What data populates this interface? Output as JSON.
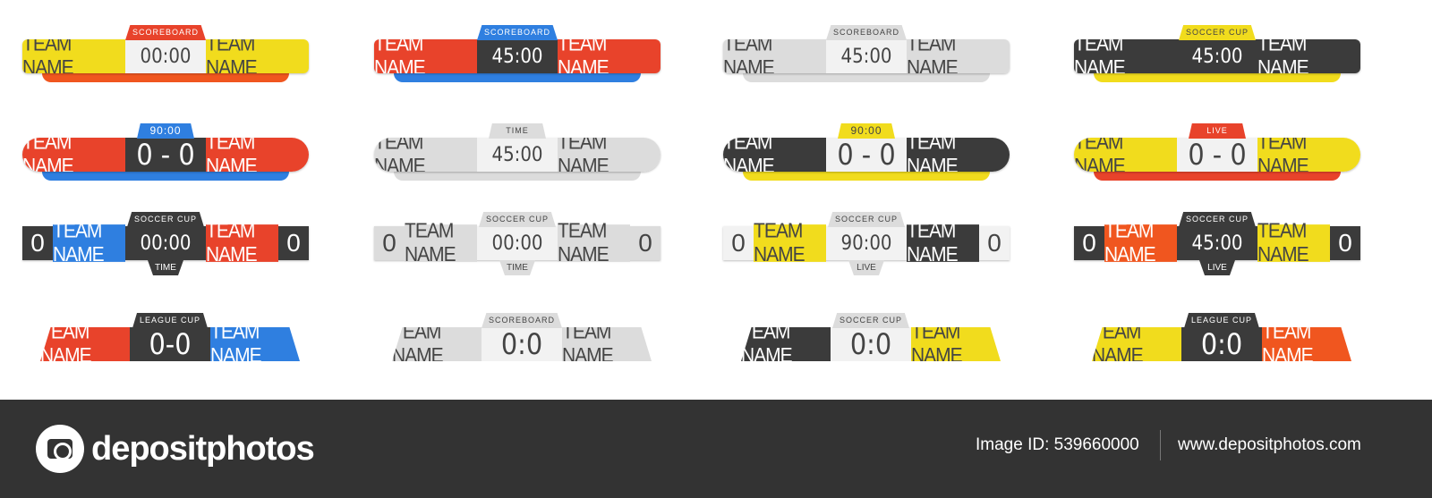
{
  "colors": {
    "yellow": "#f1dc1d",
    "red": "#e8432b",
    "blue": "#2f7fe0",
    "orange": "#f0561f",
    "dark": "#3b3b3b",
    "silver": "#dcdcdc",
    "light": "#f2f2f2"
  },
  "boards": [
    {
      "style": "round",
      "left": "TEAM NAME",
      "right": "TEAM NAME",
      "lc": "yellow",
      "rc": "yellow",
      "cc": "light",
      "center": "00:00",
      "top": "SCOREBOARD",
      "tc": "red",
      "bc": "orange"
    },
    {
      "style": "round",
      "left": "TEAM NAME",
      "right": "TEAM NAME",
      "lc": "red",
      "rc": "red",
      "cc": "dark",
      "center": "45:00",
      "top": "SCOREBOARD",
      "tc": "blue",
      "bc": "blue"
    },
    {
      "style": "round",
      "left": "TEAM NAME",
      "right": "TEAM NAME",
      "lc": "silver",
      "rc": "silver",
      "cc": "light",
      "center": "45:00",
      "top": "SCOREBOARD",
      "tc": "silver",
      "bc": "silver"
    },
    {
      "style": "round",
      "left": "TEAM NAME",
      "right": "TEAM NAME",
      "lc": "dark",
      "rc": "dark",
      "cc": "dark",
      "center": "45:00",
      "top": "SOCCER CUP",
      "tc": "yellow",
      "bc": "yellow"
    },
    {
      "style": "pill",
      "left": "TEAM NAME",
      "right": "TEAM NAME",
      "lc": "red",
      "rc": "red",
      "cc": "dark",
      "center": "0 - 0",
      "top": "90:00",
      "tc": "blue",
      "bc": "blue"
    },
    {
      "style": "pill",
      "left": "TEAM NAME",
      "right": "TEAM NAME",
      "lc": "silver",
      "rc": "silver",
      "cc": "light",
      "center": "45:00",
      "top": "TIME",
      "tc": "silver",
      "bc": "silver"
    },
    {
      "style": "pill",
      "left": "TEAM NAME",
      "right": "TEAM NAME",
      "lc": "dark",
      "rc": "dark",
      "cc": "light",
      "center": "0 - 0",
      "top": "90:00",
      "tc": "yellow",
      "bc": "yellow"
    },
    {
      "style": "pill",
      "left": "TEAM NAME",
      "right": "TEAM NAME",
      "lc": "yellow",
      "rc": "yellow",
      "cc": "light",
      "center": "0 - 0",
      "top": "LIVE",
      "tc": "red",
      "bc": "red"
    },
    {
      "style": "scores",
      "left": "TEAM NAME",
      "right": "TEAM NAME",
      "lc": "blue",
      "rc": "red",
      "cc": "dark",
      "sc": "dark",
      "ls": "0",
      "rs": "0",
      "center": "00:00",
      "top": "SOCCER CUP",
      "tc": "dark",
      "bottom": "TIME"
    },
    {
      "style": "scores",
      "left": "TEAM NAME",
      "right": "TEAM NAME",
      "lc": "silver",
      "rc": "silver",
      "cc": "light",
      "sc": "silver",
      "ls": "0",
      "rs": "0",
      "center": "00:00",
      "top": "SOCCER CUP",
      "tc": "silver",
      "bottom": "TIME"
    },
    {
      "style": "scores",
      "left": "TEAM NAME",
      "right": "TEAM NAME",
      "lc": "yellow",
      "rc": "dark",
      "cc": "light",
      "sc": "light",
      "ls": "0",
      "rs": "0",
      "center": "90:00",
      "top": "SOCCER CUP",
      "tc": "silver",
      "bottom": "LIVE"
    },
    {
      "style": "scores",
      "left": "TEAM NAME",
      "right": "TEAM NAME",
      "lc": "orange",
      "rc": "yellow",
      "cc": "dark",
      "sc": "dark",
      "ls": "0",
      "rs": "0",
      "center": "45:00",
      "top": "SOCCER CUP",
      "tc": "dark",
      "bottom": "LIVE"
    },
    {
      "style": "slant",
      "left": "TEAM NAME",
      "right": "TEAM NAME",
      "lc": "red",
      "rc": "blue",
      "cc": "dark",
      "center": "0-0",
      "top": "LEAGUE CUP",
      "tc": "dark"
    },
    {
      "style": "slant",
      "left": "TEAM NAME",
      "right": "TEAM NAME",
      "lc": "silver",
      "rc": "silver",
      "cc": "light",
      "center": "0:0",
      "top": "SCOREBOARD",
      "tc": "silver"
    },
    {
      "style": "slant",
      "left": "TEAM NAME",
      "right": "TEAM NAME",
      "lc": "dark",
      "rc": "yellow",
      "cc": "light",
      "center": "0:0",
      "top": "SOCCER CUP",
      "tc": "silver"
    },
    {
      "style": "slant",
      "left": "TEAM NAME",
      "right": "TEAM NAME",
      "lc": "yellow",
      "rc": "orange",
      "cc": "dark",
      "center": "0:0",
      "top": "LEAGUE CUP",
      "tc": "dark"
    }
  ],
  "footer": {
    "brand": "depositphotos",
    "image_id": "Image ID: 539660000",
    "site": "www.depositphotos.com"
  }
}
